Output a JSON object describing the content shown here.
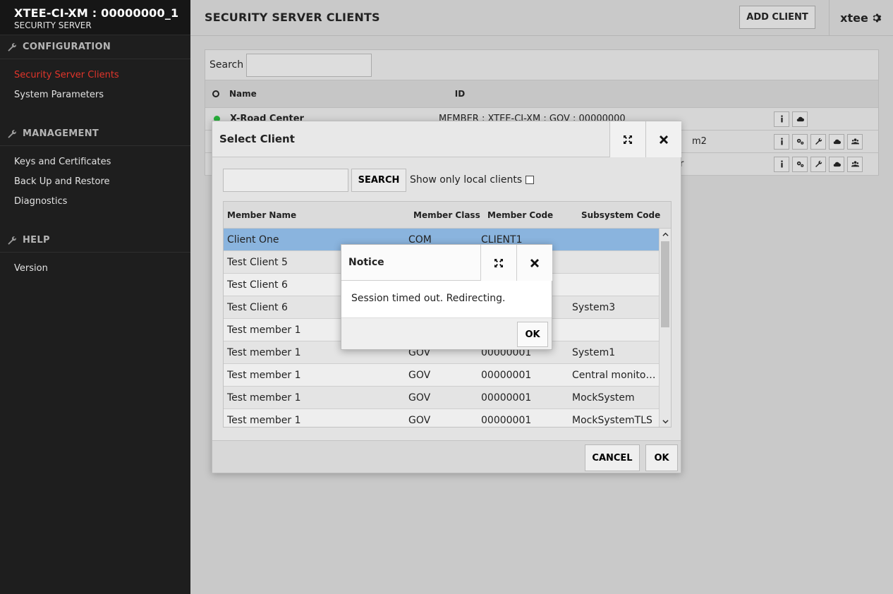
{
  "brand": {
    "title": "XTEE-CI-XM : 00000000_1",
    "subtitle": "SECURITY SERVER"
  },
  "sidebar": {
    "sections": [
      {
        "label": "CONFIGURATION",
        "items": [
          "Security Server Clients",
          "System Parameters"
        ]
      },
      {
        "label": "MANAGEMENT",
        "items": [
          "Keys and Certificates",
          "Back Up and Restore",
          "Diagnostics"
        ]
      },
      {
        "label": "HELP",
        "items": [
          "Version"
        ]
      }
    ],
    "active_item": "Security Server Clients"
  },
  "header": {
    "title": "SECURITY SERVER CLIENTS",
    "add_client": "ADD CLIENT",
    "user": "xtee"
  },
  "main": {
    "search_label": "Search",
    "columns": {
      "name": "Name",
      "id": "ID"
    },
    "rows": [
      {
        "name": "X-Road Center",
        "id": "MEMBER : XTEE-CI-XM : GOV : 00000000"
      },
      {
        "name": "",
        "id": "m2"
      },
      {
        "name": "",
        "id": "r"
      }
    ]
  },
  "select_dialog": {
    "title": "Select Client",
    "search_button": "SEARCH",
    "local_label": "Show only local clients",
    "columns": [
      "Member Name",
      "Member Class",
      "Member Code",
      "Subsystem Code"
    ],
    "rows": [
      [
        "Client One",
        "COM",
        "CLIENT1",
        ""
      ],
      [
        "Test Client 5",
        "",
        "",
        ""
      ],
      [
        "Test Client 6",
        "",
        "",
        ""
      ],
      [
        "Test Client 6",
        "",
        "",
        "System3"
      ],
      [
        "Test member 1",
        "",
        "",
        ""
      ],
      [
        "Test member 1",
        "GOV",
        "00000001",
        "System1"
      ],
      [
        "Test member 1",
        "GOV",
        "00000001",
        "Central monito…"
      ],
      [
        "Test member 1",
        "GOV",
        "00000001",
        "MockSystem"
      ],
      [
        "Test member 1",
        "GOV",
        "00000001",
        "MockSystemTLS"
      ]
    ],
    "selected_row": 0,
    "cancel": "CANCEL",
    "ok": "OK"
  },
  "notice": {
    "title": "Notice",
    "message": "Session timed out. Redirecting.",
    "ok": "OK"
  }
}
